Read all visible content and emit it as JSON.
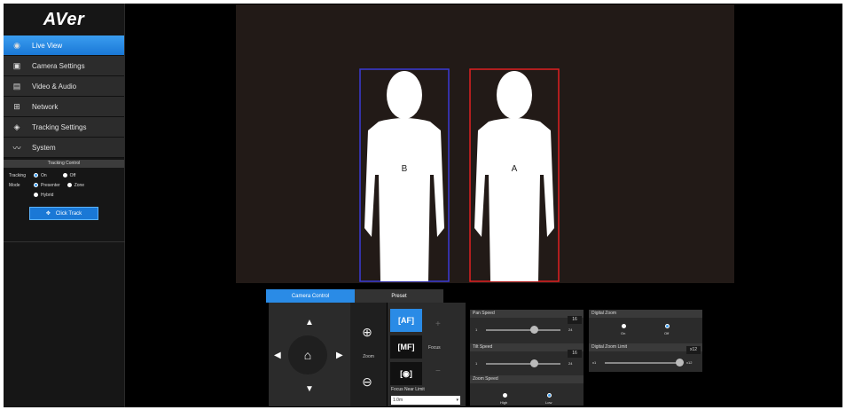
{
  "brand": {
    "logo": "AVer"
  },
  "sidebar": {
    "items": [
      {
        "label": "Live View",
        "icon": "eye-icon",
        "active": true
      },
      {
        "label": "Camera Settings",
        "icon": "image-icon",
        "active": false
      },
      {
        "label": "Video & Audio",
        "icon": "film-icon",
        "active": false
      },
      {
        "label": "Network",
        "icon": "network-icon",
        "active": false
      },
      {
        "label": "Tracking Settings",
        "icon": "crosshair-icon",
        "active": false
      },
      {
        "label": "System",
        "icon": "pulse-icon",
        "active": false
      }
    ],
    "tracking_control": {
      "header": "Tracking Control",
      "tracking_label": "Tracking",
      "on_label": "On",
      "off_label": "Off",
      "mode_label": "Mode",
      "presenter_label": "Presenter",
      "zone_label": "Zone",
      "hybrid_label": "Hybrid",
      "click_track_label": "Click Track"
    }
  },
  "video": {
    "persons": [
      {
        "letter": "B",
        "box_color": "#3a3ad6"
      },
      {
        "letter": "A",
        "box_color": "#e02020"
      }
    ]
  },
  "panel": {
    "tabs": [
      {
        "label": "Camera Control",
        "active": true
      },
      {
        "label": "Preset",
        "active": false
      }
    ],
    "zoom_label": "Zoom",
    "af_label": "[AF]",
    "mf_label": "[MF]",
    "focus_label": "Focus",
    "focus_near_limit_label": "Focus Near Limit",
    "focus_near_limit_value": "1.0m",
    "pan_speed": {
      "label": "Pan Speed",
      "value": "16",
      "min": "1",
      "max": "24",
      "fraction": 0.65
    },
    "tilt_speed": {
      "label": "Tilt Speed",
      "value": "16",
      "min": "1",
      "max": "24",
      "fraction": 0.65
    },
    "zoom_speed": {
      "label": "Zoom Speed",
      "high_label": "High",
      "low_label": "Low",
      "selected": "Low"
    },
    "digital_zoom": {
      "label": "Digital Zoom",
      "on_label": "On",
      "off_label": "Off",
      "selected": "Off"
    },
    "digital_zoom_limit": {
      "label": "Digital Zoom Limit",
      "value": "x12",
      "min": "x1",
      "max": "x12",
      "fraction": 1.0
    }
  },
  "colors": {
    "accent": "#2a8be6",
    "sidebar_bg": "#161616",
    "video_bg": "#221a17"
  }
}
